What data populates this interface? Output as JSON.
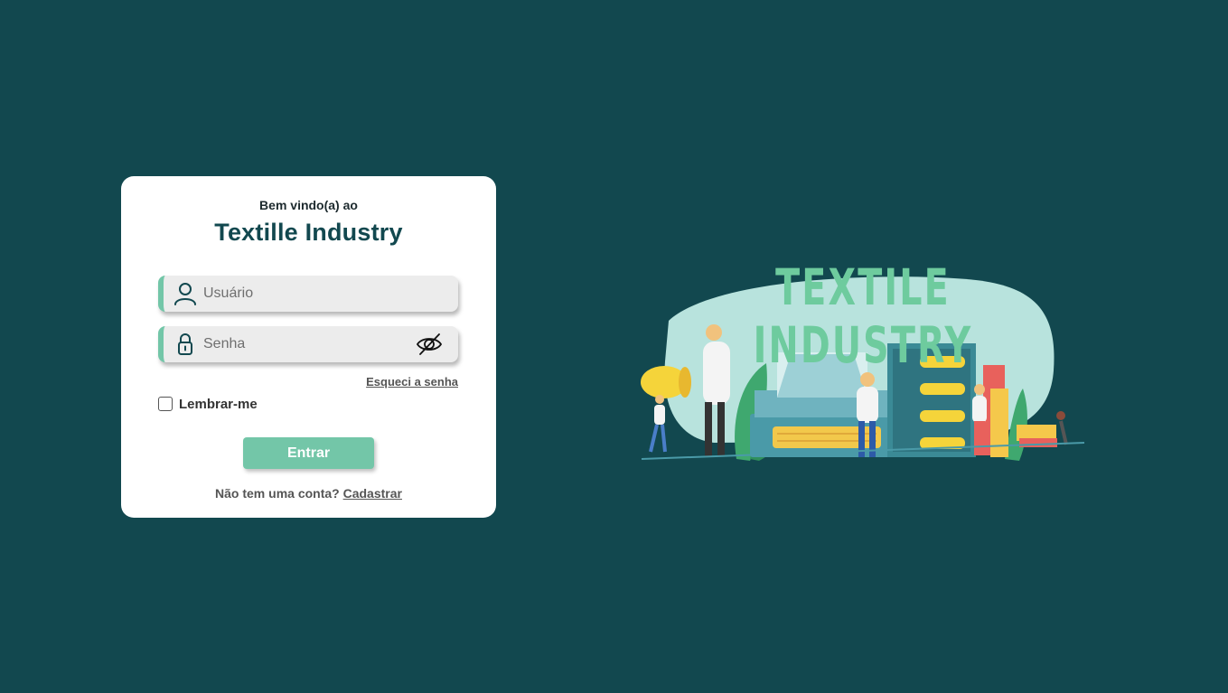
{
  "login": {
    "welcome": "Bem vindo(a) ao",
    "title": "Textille Industry",
    "username_placeholder": "Usuário",
    "password_placeholder": "Senha",
    "forgot_password": "Esqueci a senha",
    "remember_me": "Lembrar-me",
    "remember_checked": false,
    "submit_label": "Entrar",
    "signup_prompt": "Não tem uma conta?",
    "signup_link": "Cadastrar"
  },
  "illustration": {
    "title": "TEXTILE INDUSTRY"
  },
  "icons": {
    "username": "user-icon",
    "password": "lock-icon",
    "toggle_password": "eye-off-icon"
  },
  "colors": {
    "background": "#12484f",
    "accent": "#73c6a8",
    "title": "#12484f",
    "card": "#ffffff",
    "field": "#ececec"
  }
}
